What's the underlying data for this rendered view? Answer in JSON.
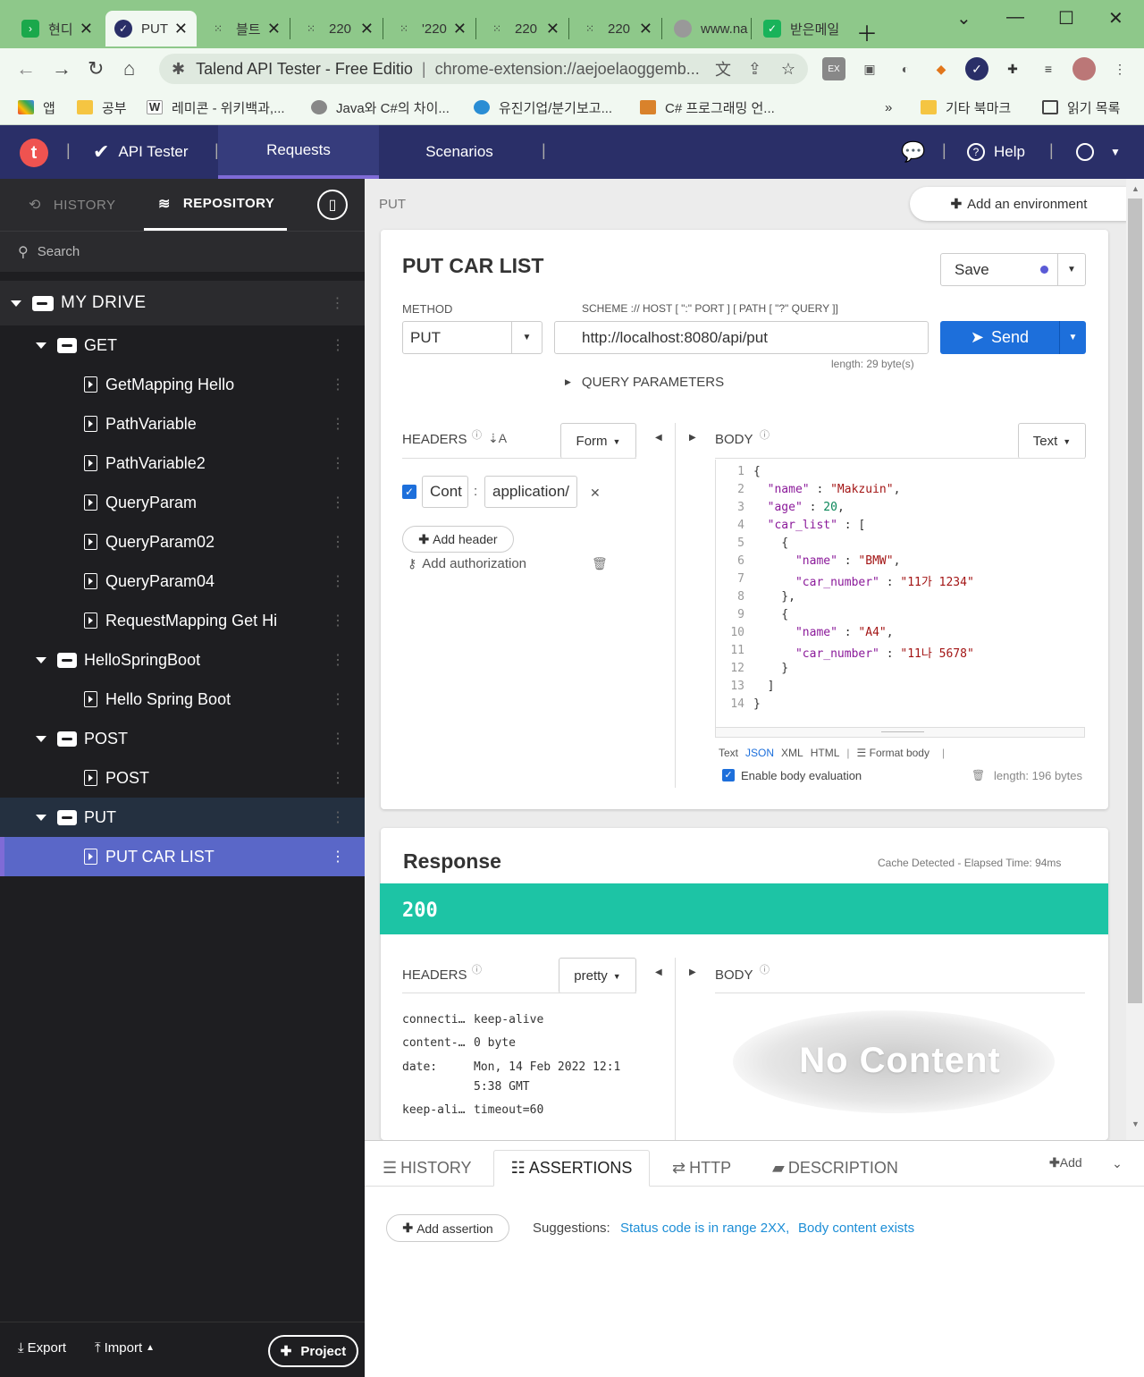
{
  "browser": {
    "tabs": [
      {
        "label": "현디",
        "fav_color": "#1aa84b"
      },
      {
        "label": "PUT",
        "fav_color": "#2a2f68"
      },
      {
        "label": "블트",
        "fav_color": "#333"
      },
      {
        "label": "220",
        "fav_color": "#333"
      },
      {
        "label": "'220",
        "fav_color": "#333"
      },
      {
        "label": "220",
        "fav_color": "#333"
      },
      {
        "label": "220",
        "fav_color": "#333"
      },
      {
        "label": "www.na",
        "fav_color": "#888"
      },
      {
        "label": "받은메일",
        "fav_color": "#19b35a"
      }
    ],
    "address_title": "Talend API Tester - Free Editio",
    "address_sep": "|",
    "address_url": "chrome-extension://aejoelaoggemb...",
    "bookmarks": [
      {
        "label": "앱",
        "color": "#e94235"
      },
      {
        "label": "공부",
        "color": "#f5c542"
      },
      {
        "label": "레미콘 - 위키백과,...",
        "color": "#ffffff"
      },
      {
        "label": "Java와 C#의 차이...",
        "color": "#555555"
      },
      {
        "label": "유진기업/분기보고...",
        "color": "#2a8dd4"
      },
      {
        "label": "C# 프로그래밍 언...",
        "color": "#d9822b"
      }
    ],
    "bookmarks_more": "»",
    "other_bookmarks": "기타 북마크",
    "reading_list": "읽기 목록"
  },
  "app": {
    "logo": "t",
    "name": "API Tester",
    "nav": [
      "Requests",
      "Scenarios"
    ],
    "help": "Help"
  },
  "sidebar": {
    "tabs": [
      "HISTORY",
      "REPOSITORY"
    ],
    "search_placeholder": "Search",
    "drive": "MY DRIVE",
    "tree": [
      {
        "type": "folder",
        "label": "GET"
      },
      {
        "type": "file",
        "label": "GetMapping Hello"
      },
      {
        "type": "file",
        "label": "PathVariable"
      },
      {
        "type": "file",
        "label": "PathVariable2"
      },
      {
        "type": "file",
        "label": "QueryParam"
      },
      {
        "type": "file",
        "label": "QueryParam02"
      },
      {
        "type": "file",
        "label": "QueryParam04"
      },
      {
        "type": "file",
        "label": "RequestMapping Get Hi"
      },
      {
        "type": "folder",
        "label": "HelloSpringBoot"
      },
      {
        "type": "file",
        "label": "Hello Spring Boot"
      },
      {
        "type": "folder",
        "label": "POST"
      },
      {
        "type": "file",
        "label": "POST"
      },
      {
        "type": "folder",
        "label": "PUT"
      },
      {
        "type": "file",
        "label": "PUT CAR LIST"
      }
    ],
    "export": "Export",
    "import": "Import",
    "project": "Project"
  },
  "request": {
    "breadcrumb": "PUT",
    "add_environment": "Add an environment",
    "title": "PUT CAR LIST",
    "save": "Save",
    "method_label": "METHOD",
    "method": "PUT",
    "url_label": "SCHEME :// HOST [ \":\" PORT ] [ PATH [ \"?\" QUERY ]]",
    "url": "http://localhost:8080/api/put",
    "send": "Send",
    "length": "length: 29 byte(s)",
    "query_params": "QUERY PARAMETERS",
    "headers_label": "HEADERS",
    "headers_mode": "Form",
    "header_key": "Cont",
    "header_sep": ":",
    "header_value": "application/",
    "add_header": "Add header",
    "add_authorization": "Add authorization",
    "body_label": "BODY",
    "body_mode": "Text",
    "body_lines": [
      "{",
      "  \"name\" : \"Makzuin\",",
      "  \"age\" : 20,",
      "  \"car_list\" : [",
      "    {",
      "      \"name\" : \"BMW\",",
      "      \"car_number\" : \"11가 1234\"",
      "    },",
      "    {",
      "      \"name\" : \"A4\",",
      "      \"car_number\" : \"11나 5678\"",
      "    }",
      "  ]",
      "}"
    ],
    "formats": [
      "Text",
      "JSON",
      "XML",
      "HTML"
    ],
    "format_body": "Format body",
    "enable_eval": "Enable body evaluation",
    "body_length": "length: 196 bytes"
  },
  "response": {
    "title": "Response",
    "meta": "Cache Detected - Elapsed Time: 94ms",
    "status": "200",
    "status_color": "#1dc4a5",
    "headers_label": "HEADERS",
    "headers_mode": "pretty",
    "headers": [
      {
        "k": "connecti…",
        "v": "keep-alive"
      },
      {
        "k": "content-…",
        "v": "0 byte"
      },
      {
        "k": "date:",
        "v": "Mon, 14 Feb 2022 12:1"
      },
      {
        "k": "",
        "v": "5:38 GMT"
      },
      {
        "k": "keep-ali…",
        "v": "timeout=60"
      }
    ],
    "body_label": "BODY",
    "no_content": "No Content"
  },
  "bottom": {
    "tabs": [
      "HISTORY",
      "ASSERTIONS",
      "HTTP",
      "DESCRIPTION"
    ],
    "add": "Add",
    "add_assertion": "Add assertion",
    "suggestions_label": "Suggestions:",
    "suggestions": [
      "Status code is in range 2XX,",
      "Body content exists"
    ]
  }
}
